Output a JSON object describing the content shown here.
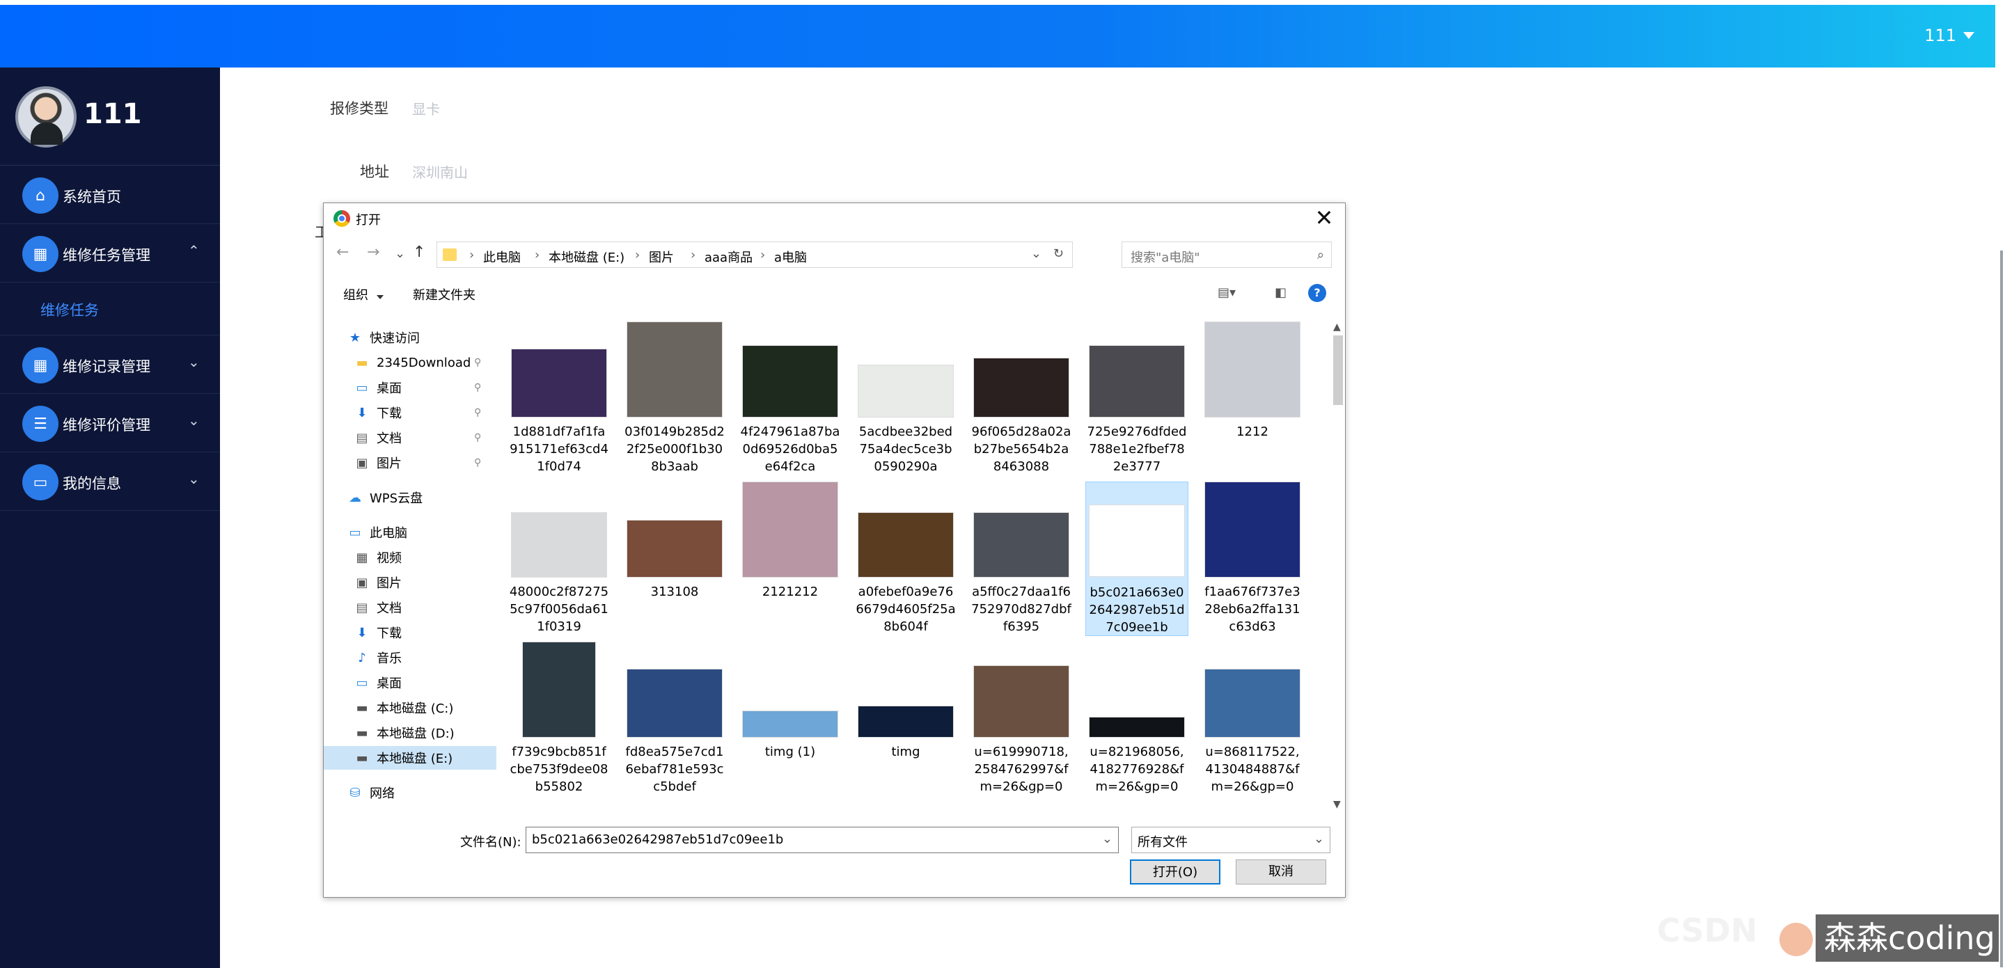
{
  "header": {
    "user": "111"
  },
  "sidebar": {
    "username": "111",
    "items": [
      {
        "label": "系统首页",
        "icon": "home-icon"
      },
      {
        "label": "维修任务管理",
        "icon": "grid-icon",
        "expanded": true,
        "sub": [
          "维修任务"
        ]
      },
      {
        "label": "维修记录管理",
        "icon": "grid-icon"
      },
      {
        "label": "维修评价管理",
        "icon": "list-icon"
      },
      {
        "label": "我的信息",
        "icon": "card-icon"
      }
    ]
  },
  "form": {
    "repair_type_label": "报修类型",
    "repair_type_value": "显卡",
    "address_label": "地址",
    "address_value": "深圳南山",
    "partial_label": "工"
  },
  "dialog": {
    "title": "打开",
    "path": [
      "此电脑",
      "本地磁盘 (E:)",
      "图片",
      "aaa商品",
      "a电脑"
    ],
    "search_placeholder": "搜索\"a电脑\"",
    "organize": "组织",
    "new_folder": "新建文件夹",
    "tree": [
      {
        "label": "快速访问",
        "icon": "star-icon",
        "indent": 0
      },
      {
        "label": "2345Download",
        "icon": "folder-icon",
        "indent": 1,
        "pin": true
      },
      {
        "label": "桌面",
        "icon": "desktop-icon",
        "indent": 1,
        "pin": true
      },
      {
        "label": "下载",
        "icon": "download-icon",
        "indent": 1,
        "pin": true
      },
      {
        "label": "文档",
        "icon": "document-icon",
        "indent": 1,
        "pin": true
      },
      {
        "label": "图片",
        "icon": "picture-icon",
        "indent": 1,
        "pin": true
      },
      {
        "label": "",
        "icon": "",
        "indent": 0
      },
      {
        "label": "WPS云盘",
        "icon": "cloud-icon",
        "indent": 0
      },
      {
        "label": "",
        "icon": "",
        "indent": 0
      },
      {
        "label": "此电脑",
        "icon": "computer-icon",
        "indent": 0
      },
      {
        "label": "视频",
        "icon": "video-icon",
        "indent": 1
      },
      {
        "label": "图片",
        "icon": "picture-icon",
        "indent": 1
      },
      {
        "label": "文档",
        "icon": "document-icon",
        "indent": 1
      },
      {
        "label": "下载",
        "icon": "download-icon",
        "indent": 1
      },
      {
        "label": "音乐",
        "icon": "music-icon",
        "indent": 1
      },
      {
        "label": "桌面",
        "icon": "desktop-icon",
        "indent": 1
      },
      {
        "label": "本地磁盘 (C:)",
        "icon": "drive-icon",
        "indent": 1
      },
      {
        "label": "本地磁盘 (D:)",
        "icon": "drive-icon",
        "indent": 1
      },
      {
        "label": "本地磁盘 (E:)",
        "icon": "drive-icon",
        "indent": 1,
        "selected": true
      },
      {
        "label": "",
        "icon": "",
        "indent": 0
      },
      {
        "label": "网络",
        "icon": "network-icon",
        "indent": 0
      }
    ],
    "files": [
      {
        "name": "1d881df7af1fa915171ef63cd41f0d74",
        "color": "#3a2a5a",
        "ratio": 0.72
      },
      {
        "name": "03f0149b285d22f25e000f1b308b3aab",
        "color": "#6b6560",
        "ratio": 1.0
      },
      {
        "name": "4f247961a87ba0d69526d0ba5e64f2ca",
        "color": "#1f2a1e",
        "ratio": 0.75
      },
      {
        "name": "5acdbee32bed75a4dec5ce3b0590290a",
        "color": "#e8ebe8",
        "ratio": 0.55
      },
      {
        "name": "96f065d28a02ab27be5654b2a8463088",
        "color": "#2a2020",
        "ratio": 0.62
      },
      {
        "name": "725e9276dfded788e1e2fbef782e3777",
        "color": "#4a4a50",
        "ratio": 0.75
      },
      {
        "name": "1212",
        "color": "#c9ccd2",
        "ratio": 1.0
      },
      {
        "name": "48000c2f872755c97f0056da611f0319",
        "color": "#d9dadb",
        "ratio": 0.68
      },
      {
        "name": "313108",
        "color": "#7a4c3a",
        "ratio": 0.6
      },
      {
        "name": "2121212",
        "color": "#b896a4",
        "ratio": 1.0
      },
      {
        "name": "a0febef0a9e766679d4605f25a8b604f",
        "color": "#5a3c20",
        "ratio": 0.68
      },
      {
        "name": "a5ff0c27daa1f6752970d827dbff6395",
        "color": "#4c5058",
        "ratio": 0.68
      },
      {
        "name": "b5c021a663e02642987eb51d7c09ee1b",
        "color": "#ffffff",
        "ratio": 0.75
      },
      {
        "name": "f1aa676f737e328eb6a2ffa131c63d63",
        "color": "#1c2a7a",
        "ratio": 1.0
      },
      {
        "name": "f739c9bcb851fcbe753f9dee08b55802",
        "color": "#2c3a44",
        "ratio": 1.3
      },
      {
        "name": "fd8ea575e7cd16ebaf781e593cc5bdef",
        "color": "#2a4a80",
        "ratio": 0.72
      },
      {
        "name": "timg (1)",
        "color": "#6ea6d8",
        "ratio": 0.28
      },
      {
        "name": "timg",
        "color": "#0e1e3a",
        "ratio": 0.33
      },
      {
        "name": "u=619990718,2584762997&fm=26&gp=0",
        "color": "#6a5040",
        "ratio": 0.75
      },
      {
        "name": "u=821968056,4182776928&fm=26&gp=0",
        "color": "#101418",
        "ratio": 0.22
      },
      {
        "name": "u=868117522,4130484887&fm=26&gp=0",
        "color": "#3a6aa0",
        "ratio": 0.72
      }
    ],
    "selected_file": "b5c021a663e02642987eb51d7c09ee1b",
    "filename_label": "文件名(N):",
    "filename_value": "b5c021a663e02642987eb51d7c09ee1b",
    "filetype": "所有文件",
    "open_button": "打开(O)",
    "cancel_button": "取消"
  },
  "watermark": {
    "text": "森森coding"
  }
}
